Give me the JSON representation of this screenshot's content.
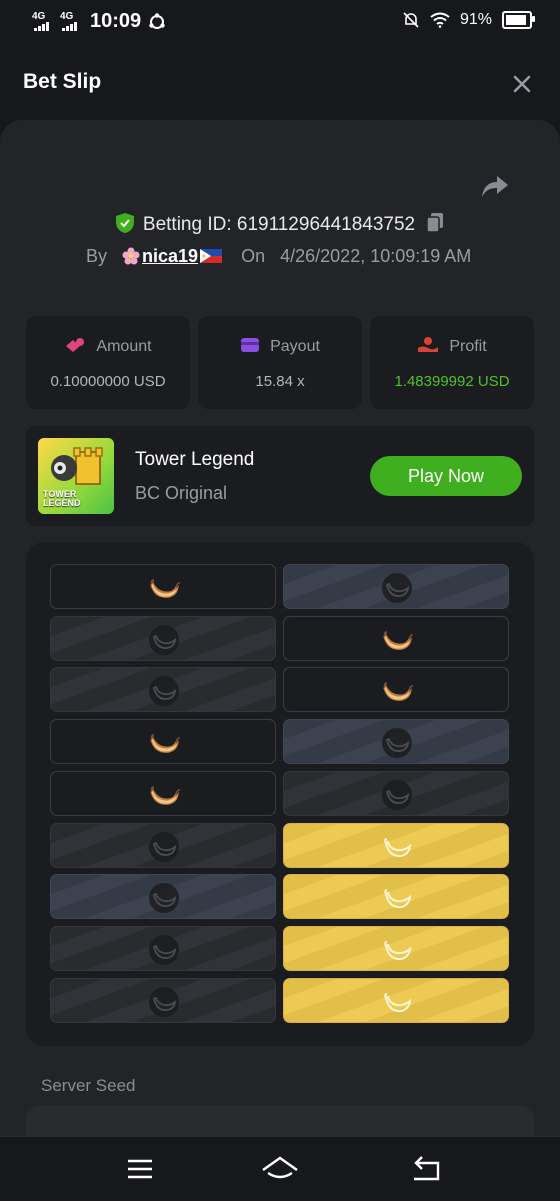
{
  "status_bar": {
    "net1": "4G",
    "net2": "4G",
    "time": "10:09",
    "battery": "91%"
  },
  "header": {
    "title": "Bet Slip"
  },
  "bet": {
    "id_label": "Betting ID: 61911296441843752",
    "by_label": "By",
    "user": "nica19",
    "on_label": "On",
    "date": "4/26/2022, 10:09:19 AM"
  },
  "stats": [
    {
      "label": "Amount",
      "value": "0.10000000 USD",
      "icon": "coins-icon",
      "color": "#e0447a"
    },
    {
      "label": "Payout",
      "value": "15.84 x",
      "icon": "wallet-icon",
      "color": "#8b4fe0"
    },
    {
      "label": "Profit",
      "value": "1.48399992 USD",
      "icon": "hand-coin-icon",
      "color": "#d84338",
      "value_color": "#4fc22a"
    }
  ],
  "game": {
    "name": "Tower Legend",
    "provider": "BC Original",
    "thumb_text_line1": "TOWER",
    "thumb_text_line2": "LEGEND",
    "play_label": "Play Now"
  },
  "board": {
    "rows": [
      [
        "banana",
        "bluish"
      ],
      [
        "stripe",
        "banana"
      ],
      [
        "stripe",
        "banana"
      ],
      [
        "banana",
        "bluish"
      ],
      [
        "banana",
        "stripe"
      ],
      [
        "stripe",
        "gold"
      ],
      [
        "bluish",
        "gold"
      ],
      [
        "stripe",
        "gold"
      ],
      [
        "stripe",
        "gold"
      ]
    ]
  },
  "seed": {
    "label": "Server Seed"
  },
  "colors": {
    "background": "#17181b",
    "panel": "#232427",
    "card": "#1b1c1f",
    "accent_green": "#3fae1f",
    "profit_green": "#4fc22a",
    "gold": "#e2bf48"
  }
}
